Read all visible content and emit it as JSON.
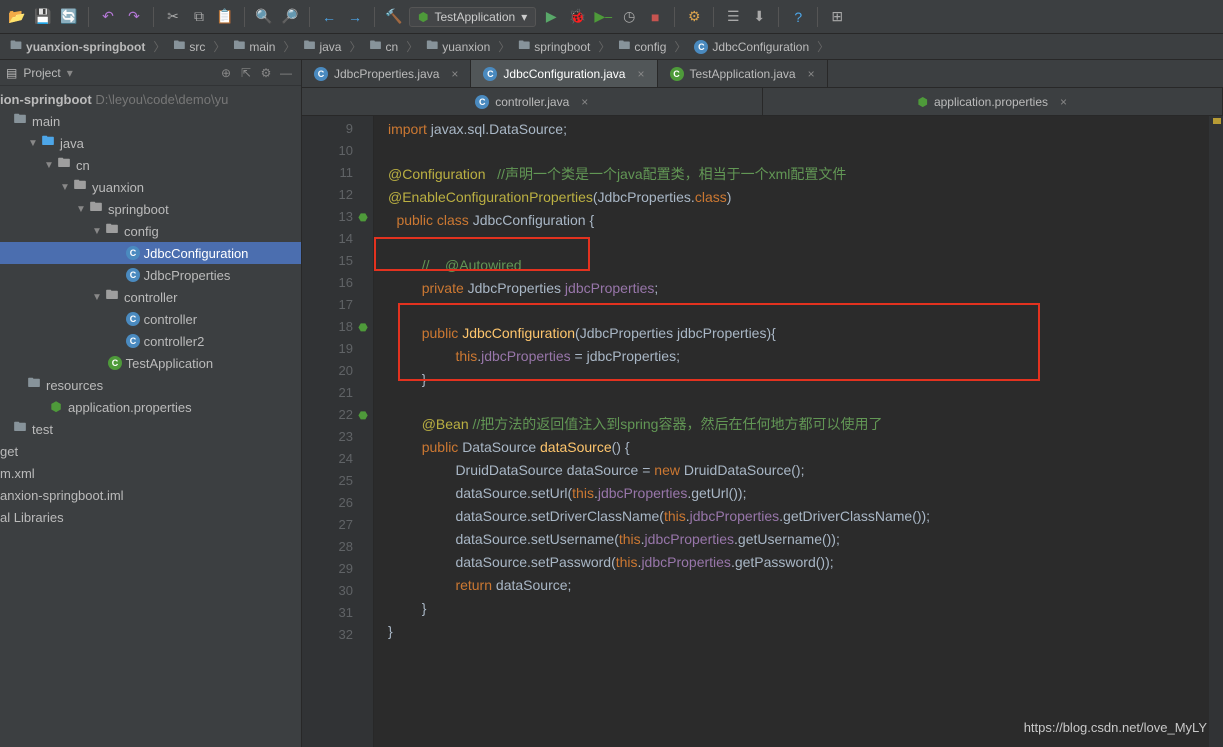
{
  "toolbar": {
    "open_icon": "open",
    "save_icon": "save",
    "sync_icon": "sync",
    "undo_icon": "undo",
    "redo_icon": "redo",
    "cut_icon": "cut",
    "copy_icon": "copy",
    "paste_icon": "paste",
    "find_icon": "find",
    "replace_icon": "replace",
    "back_icon": "back",
    "fwd_icon": "forward",
    "build_icon": "build",
    "run_config": "TestApplication",
    "run_icon": "run",
    "debug_icon": "debug",
    "coverage_icon": "coverage",
    "profile_icon": "profile",
    "stop_icon": "stop",
    "settings_icon": "settings",
    "structure_icon": "structure",
    "download_icon": "download",
    "help_icon": "help",
    "sw_icon": "switch"
  },
  "breadcrumb": {
    "proj": "yuanxion-springboot",
    "p1": "src",
    "p2": "main",
    "p3": "java",
    "p4": "cn",
    "p5": "yuanxion",
    "p6": "springboot",
    "p7": "config",
    "cls": "JdbcConfiguration"
  },
  "toolwindow": {
    "title": "Project"
  },
  "tree": {
    "root": "ion-springboot",
    "root_path": "D:\\leyou\\code\\demo\\yu",
    "main": "main",
    "java": "java",
    "cn": "cn",
    "yuanxion": "yuanxion",
    "springboot": "springboot",
    "config": "config",
    "JdbcConfiguration": "JdbcConfiguration",
    "JdbcProperties": "JdbcProperties",
    "controller": "controller",
    "controllerA": "controller",
    "controllerB": "controller2",
    "TestApplication": "TestApplication",
    "resources": "resources",
    "appprop": "application.properties",
    "test": "test",
    "get": "get",
    "mxml": "m.xml",
    "iml": "anxion-springboot.iml",
    "libs": "al Libraries"
  },
  "tabs1": {
    "a": "JdbcProperties.java",
    "b": "JdbcConfiguration.java",
    "c": "TestApplication.java"
  },
  "tabs2": {
    "a": "controller.java",
    "b": "application.properties"
  },
  "gutter": {
    "start": 9,
    "end": 32
  },
  "code": {
    "l9a": "import",
    "l9b": " javax.sql.DataSource;",
    "l11a": "@Configuration",
    "l11b": "   //声明一个类是一个java配置类，相当于一个xml配置文件",
    "l12a": "@EnableConfigurationProperties",
    "l12b": "(JdbcProperties.",
    "l12c": "class",
    "l12d": ")",
    "l13a": "public class ",
    "l13b": "JdbcConfiguration {",
    "l15": "//    @Autowired",
    "l16a": "private ",
    "l16b": "JdbcProperties ",
    "l16c": "jdbcProperties",
    "l16d": ";",
    "l18a": "public ",
    "l18b": "JdbcConfiguration",
    "l18c": "(JdbcProperties jdbcProperties){",
    "l19a": "this",
    "l19b": ".",
    "l19c": "jdbcProperties",
    "l19d": " = jdbcProperties;",
    "l20": "}",
    "l22a": "@Bean",
    "l22b": " //把方法的返回值注入到spring容器，然后在任何地方都可以使用了",
    "l23a": "public ",
    "l23b": "DataSource ",
    "l23c": "dataSource",
    "l23d": "() {",
    "l24a": "DruidDataSource dataSource = ",
    "l24b": "new ",
    "l24c": "DruidDataSource();",
    "l25a": "dataSource.setUrl(",
    "l25b": "this",
    "l25c": ".",
    "l25d": "jdbcProperties",
    "l25e": ".getUrl());",
    "l26a": "dataSource.setDriverClassName(",
    "l26b": "this",
    "l26c": ".",
    "l26d": "jdbcProperties",
    "l26e": ".getDriverClassName());",
    "l27a": "dataSource.setUsername(",
    "l27b": "this",
    "l27c": ".",
    "l27d": "jdbcProperties",
    "l27e": ".getUsername());",
    "l28a": "dataSource.setPassword(",
    "l28b": "this",
    "l28c": ".",
    "l28d": "jdbcProperties",
    "l28e": ".getPassword());",
    "l29a": "return ",
    "l29b": "dataSource;",
    "l30": "}",
    "l31": "}"
  },
  "watermark": "https://blog.csdn.net/love_MyLY"
}
